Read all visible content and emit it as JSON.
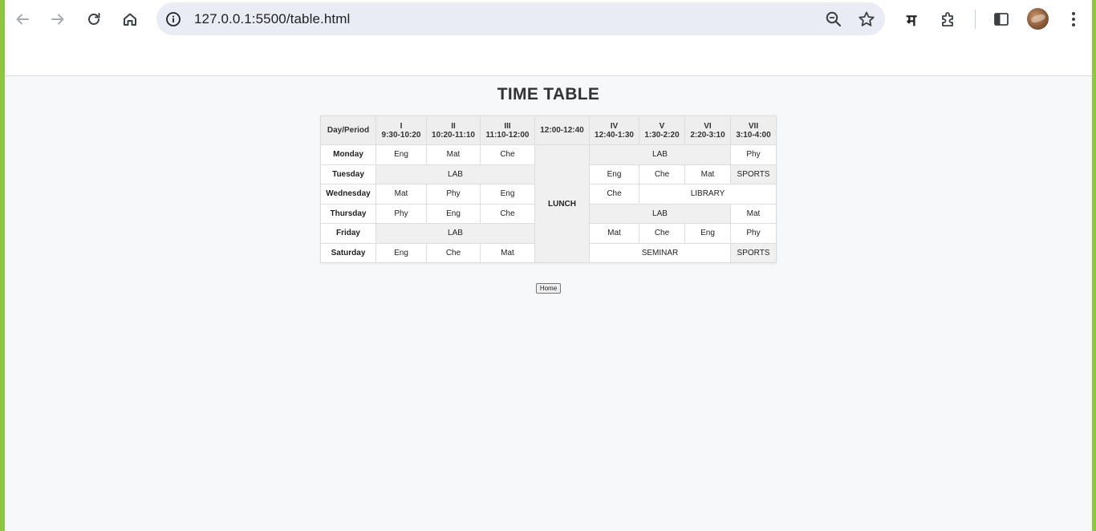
{
  "browser": {
    "url": "127.0.0.1:5500/table.html",
    "translate_glyph": "म",
    "icons": [
      "back-icon",
      "forward-icon",
      "reload-icon",
      "home-icon",
      "site-info-icon",
      "zoom-out-icon",
      "bookmark-star-icon",
      "translate-icon",
      "extensions-icon",
      "side-panel-icon",
      "profile-avatar",
      "menu-icon"
    ]
  },
  "page": {
    "title": "TIME TABLE",
    "home_button": "Home"
  },
  "table": {
    "headers": [
      {
        "roman": "Day/Period",
        "time": ""
      },
      {
        "roman": "I",
        "time": "9:30-10:20"
      },
      {
        "roman": "II",
        "time": "10:20-11:10"
      },
      {
        "roman": "III",
        "time": "11:10-12:00"
      },
      {
        "roman": "12:00-12:40",
        "time": ""
      },
      {
        "roman": "IV",
        "time": "12:40-1:30"
      },
      {
        "roman": "V",
        "time": "1:30-2:20"
      },
      {
        "roman": "VI",
        "time": "2:20-3:10"
      },
      {
        "roman": "VII",
        "time": "3:10-4:00"
      }
    ],
    "lunch": "LUNCH",
    "rows": [
      {
        "day": "Monday",
        "cells": [
          "Eng",
          "Mat",
          "Che",
          "LAB",
          "Phy"
        ]
      },
      {
        "day": "Tuesday",
        "cells": [
          "LAB",
          "Eng",
          "Che",
          "Mat",
          "SPORTS"
        ]
      },
      {
        "day": "Wednesday",
        "cells": [
          "Mat",
          "Phy",
          "Eng",
          "Che",
          "LIBRARY"
        ]
      },
      {
        "day": "Thursday",
        "cells": [
          "Phy",
          "Eng",
          "Che",
          "LAB",
          "Mat"
        ]
      },
      {
        "day": "Friday",
        "cells": [
          "LAB",
          "Mat",
          "Che",
          "Eng",
          "Phy"
        ]
      },
      {
        "day": "Saturday",
        "cells": [
          "Eng",
          "Che",
          "Mat",
          "SEMINAR",
          "SPORTS"
        ]
      }
    ]
  },
  "colors": {
    "frame_accent": "#8dc63f",
    "page_background": "#f7f8fa",
    "header_cell": "#eeeeee",
    "shaded_cell": "#f0f0f0"
  }
}
